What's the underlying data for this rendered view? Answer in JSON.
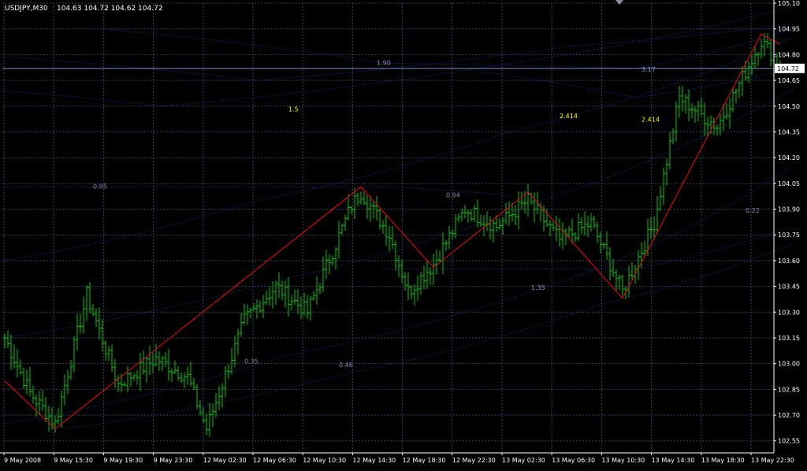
{
  "chart_data": {
    "type": "bar",
    "title": "USDJPY,M30",
    "ohlc_label": "104.63 104.72 104.62 104.72",
    "current_price_label": "104.72",
    "xlabel": "",
    "ylabel": "",
    "ylim": [
      102.48,
      105.1
    ],
    "y_ticks": [
      "105.10",
      "104.95",
      "104.80",
      "104.65",
      "104.50",
      "104.35",
      "104.20",
      "104.05",
      "103.90",
      "103.75",
      "103.60",
      "103.45",
      "103.30",
      "103.15",
      "103.00",
      "102.85",
      "102.70",
      "102.55"
    ],
    "x_ticks": [
      "9 May 2008",
      "9 May 15:30",
      "9 May 19:30",
      "9 May 23:30",
      "12 May 02:30",
      "12 May 06:30",
      "12 May 10:30",
      "12 May 14:30",
      "12 May 18:30",
      "12 May 22:30",
      "13 May 02:30",
      "13 May 06:30",
      "13 May 10:30",
      "13 May 14:30",
      "13 May 18:30",
      "13 May 22:30"
    ],
    "grid": true,
    "colors": {
      "background": "#000000",
      "bars": "#00c800",
      "zigzag": "#ff0000",
      "grid": "#3a3f5c",
      "levels": "#1a2a9a",
      "labels_yellow": "#ffff00",
      "labels_gray": "#8c8cb4",
      "axis_text": "#ffffff",
      "price_line": "#7d8cc8"
    },
    "zigzag": [
      {
        "bar": 0,
        "price": 102.9
      },
      {
        "bar": 16,
        "price": 102.62
      },
      {
        "bar": 113,
        "price": 104.03
      },
      {
        "bar": 136,
        "price": 103.56
      },
      {
        "bar": 166,
        "price": 104.0
      },
      {
        "bar": 196,
        "price": 103.38
      },
      {
        "bar": 240,
        "price": 104.92
      },
      {
        "bar": 246,
        "price": 104.86
      }
    ],
    "annotations": [
      {
        "text": "1.90",
        "bar": 118,
        "price": 104.74,
        "color": "gray"
      },
      {
        "text": "3.17",
        "bar": 202,
        "price": 104.7,
        "color": "gray"
      },
      {
        "text": "1.5",
        "bar": 90,
        "price": 104.47,
        "color": "yellow"
      },
      {
        "text": "2.414",
        "bar": 176,
        "price": 104.43,
        "color": "yellow"
      },
      {
        "text": "2.414",
        "bar": 202,
        "price": 104.41,
        "color": "yellow"
      },
      {
        "text": "0.95",
        "bar": 28,
        "price": 104.02,
        "color": "gray"
      },
      {
        "text": "0.94",
        "bar": 140,
        "price": 103.97,
        "color": "gray"
      },
      {
        "text": "0.22",
        "bar": 235,
        "price": 103.88,
        "color": "gray"
      },
      {
        "text": "1.35",
        "bar": 167,
        "price": 103.43,
        "color": "gray"
      },
      {
        "text": "0.35",
        "bar": 76,
        "price": 103.0,
        "color": "gray"
      },
      {
        "text": "0.46",
        "bar": 106,
        "price": 102.98,
        "color": "gray"
      }
    ],
    "levels": [
      [
        [
          -10,
          104.6
        ],
        [
          50,
          104.5
        ],
        [
          150,
          104.72
        ],
        [
          250,
          105.08
        ]
      ],
      [
        [
          30,
          104.95
        ],
        [
          120,
          104.75
        ],
        [
          200,
          104.72
        ],
        [
          250,
          104.95
        ]
      ],
      [
        [
          -10,
          104.8
        ],
        [
          80,
          104.65
        ],
        [
          180,
          104.85
        ],
        [
          250,
          104.98
        ]
      ],
      [
        [
          0,
          103.6
        ],
        [
          80,
          103.95
        ],
        [
          160,
          104.35
        ],
        [
          250,
          104.9
        ]
      ],
      [
        [
          0,
          103.15
        ],
        [
          90,
          103.5
        ],
        [
          170,
          103.95
        ],
        [
          250,
          104.6
        ]
      ],
      [
        [
          0,
          102.65
        ],
        [
          90,
          103.05
        ],
        [
          180,
          103.5
        ],
        [
          250,
          104.15
        ]
      ],
      [
        [
          20,
          102.62
        ],
        [
          110,
          102.95
        ],
        [
          190,
          103.35
        ],
        [
          250,
          103.7
        ]
      ],
      [
        [
          120,
          103.55
        ],
        [
          200,
          103.55
        ],
        [
          250,
          103.8
        ]
      ],
      [
        [
          150,
          104.7
        ],
        [
          200,
          104.55
        ],
        [
          250,
          104.72
        ]
      ],
      [
        [
          0,
          104.03
        ],
        [
          120,
          104.03
        ],
        [
          160,
          103.98
        ]
      ]
    ],
    "pivots": [
      [
        0,
        103.15
      ],
      [
        8,
        102.83
      ],
      [
        16,
        102.65
      ],
      [
        26,
        103.4
      ],
      [
        36,
        102.88
      ],
      [
        48,
        103.03
      ],
      [
        58,
        102.92
      ],
      [
        64,
        102.62
      ],
      [
        76,
        103.25
      ],
      [
        86,
        103.45
      ],
      [
        96,
        103.3
      ],
      [
        110,
        103.92
      ],
      [
        113,
        104.0
      ],
      [
        122,
        103.75
      ],
      [
        128,
        103.42
      ],
      [
        136,
        103.58
      ],
      [
        146,
        103.9
      ],
      [
        156,
        103.8
      ],
      [
        166,
        103.95
      ],
      [
        176,
        103.72
      ],
      [
        186,
        103.82
      ],
      [
        196,
        103.42
      ],
      [
        206,
        103.82
      ],
      [
        214,
        104.55
      ],
      [
        226,
        104.38
      ],
      [
        240,
        104.88
      ],
      [
        246,
        104.74
      ]
    ]
  }
}
